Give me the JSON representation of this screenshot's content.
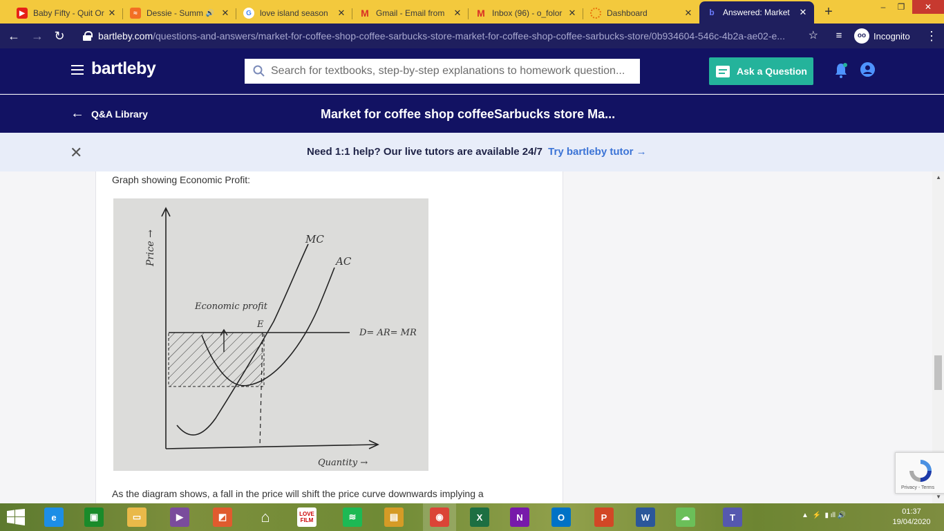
{
  "browser": {
    "tabs": [
      {
        "title": "Baby Fifty - Quit Or",
        "favicon": "youtube-icon",
        "color": "#e62117"
      },
      {
        "title": "Dessie - Summ",
        "favicon": "soundcloud-icon",
        "color": "#f26f23"
      },
      {
        "title": "love island season",
        "favicon": "google-icon",
        "color": "#4285f4"
      },
      {
        "title": "Gmail - Email from",
        "favicon": "gmail-icon",
        "color": "#d93025"
      },
      {
        "title": "Inbox (96) - o_folor",
        "favicon": "gmail-icon",
        "color": "#d93025"
      },
      {
        "title": "Dashboard",
        "favicon": "dashboard-icon",
        "color": "#e8710a"
      },
      {
        "title": "Answered: Market",
        "favicon": "bartleby-icon",
        "color": "#121263"
      }
    ],
    "url_host": "bartleby.com",
    "url_path": "/questions-and-answers/market-for-coffee-shop-coffee-sarbucks-store-market-for-coffee-shop-coffee-sarbucks-store/0b934604-546c-4b2a-ae02-e...",
    "incognito_label": "Incognito"
  },
  "header": {
    "logo": "bartleby",
    "search_placeholder": "Search for textbooks, step-by-step explanations to homework question...",
    "ask_label": "Ask a Question"
  },
  "subbar": {
    "back_label": "Q&A Library",
    "title": "Market for coffee shop coffeeSarbucks store Ma..."
  },
  "promo": {
    "message": "Need 1:1 help? Our live tutors are available 24/7",
    "cta": "Try bartleby tutor"
  },
  "content": {
    "caption": "Graph showing Economic Profit:",
    "graph_labels": {
      "y_axis": "Price →",
      "x_axis": "Quantity →",
      "mc": "MC",
      "ac": "AC",
      "demand": "D= AR= MR",
      "profit": "Economic profit",
      "point": "E"
    },
    "bottom_text": "As the diagram shows, a fall in the price will shift the price curve downwards implying a"
  },
  "recaptcha": {
    "label": "Privacy - Terms"
  },
  "taskbar": {
    "apps": [
      {
        "name": "edge",
        "label": "e",
        "color": "#1c8ee6"
      },
      {
        "name": "store",
        "label": "▣",
        "color": "#1a8b2a"
      },
      {
        "name": "file-explorer",
        "label": "▭",
        "color": "#e9b949"
      },
      {
        "name": "media",
        "label": "▶",
        "color": "#7a4c9c"
      },
      {
        "name": "photos",
        "label": "◩",
        "color": "#e05b2e"
      },
      {
        "name": "home",
        "label": "⌂",
        "color": "#ffffff"
      },
      {
        "name": "lovefilm",
        "label": "LOVE FILM",
        "color": "#ffffff"
      },
      {
        "name": "spotify",
        "label": "≋",
        "color": "#1db954"
      },
      {
        "name": "tools",
        "label": "▤",
        "color": "#d59b26"
      },
      {
        "name": "chrome",
        "label": "◉",
        "color": "#db4437"
      },
      {
        "name": "excel",
        "label": "X",
        "color": "#1d6f42"
      },
      {
        "name": "onenote",
        "label": "N",
        "color": "#7719aa"
      },
      {
        "name": "outlook",
        "label": "O",
        "color": "#0072c6"
      },
      {
        "name": "powerpoint",
        "label": "P",
        "color": "#d24726"
      },
      {
        "name": "word",
        "label": "W",
        "color": "#2b579a"
      },
      {
        "name": "cloud",
        "label": "☁",
        "color": "#6bbf59"
      },
      {
        "name": "teams",
        "label": "T",
        "color": "#5558af"
      }
    ],
    "time": "01:37",
    "date": "19/04/2020"
  }
}
